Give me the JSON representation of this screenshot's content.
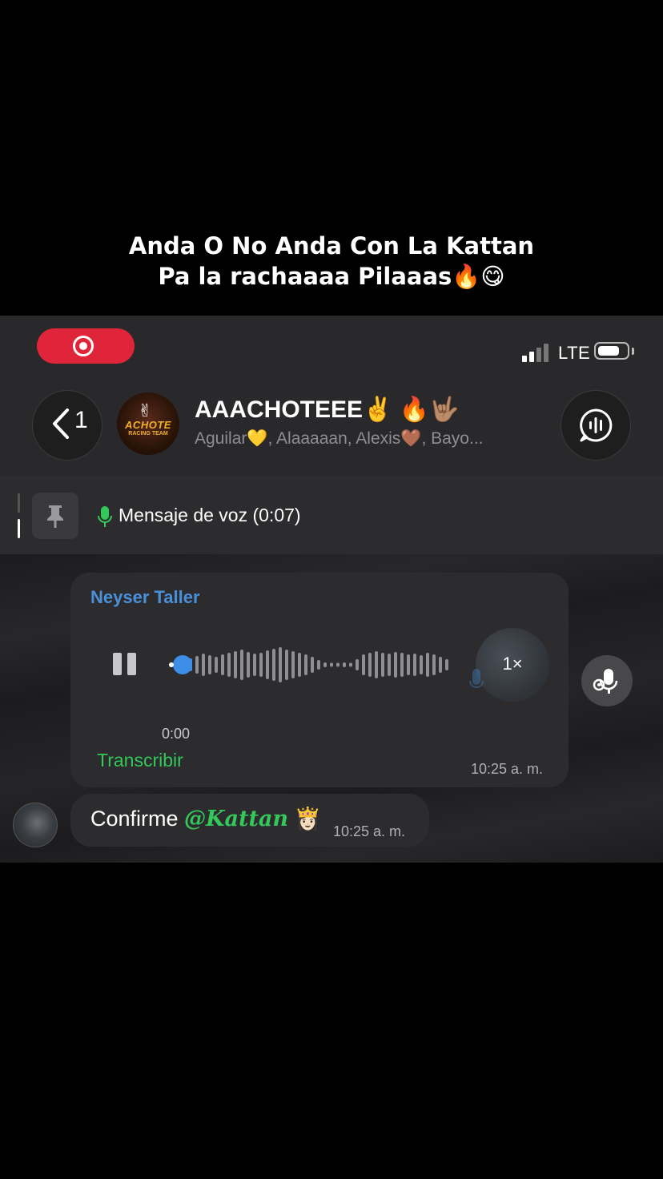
{
  "caption": {
    "line1": "Anda O No Anda Con La Kattan",
    "line2": "Pa la rachaaaa Pilaaas🔥😋"
  },
  "status_bar": {
    "network": "LTE"
  },
  "header": {
    "back_count": "1",
    "title": "AAACHOTEEE✌️ 🔥🤟🏽",
    "members": "Aguilar💛, Alaaaaan, Alexis🤎, Bayo...",
    "avatar_text": "ACHOTE",
    "avatar_subtext": "RACING TEAM"
  },
  "pinned": {
    "text": "Mensaje de voz (0:07)"
  },
  "voice_message": {
    "sender": "Neyser Taller",
    "current_time": "0:00",
    "speed": "1×",
    "transcribe_label": "Transcribir",
    "timestamp": "10:25 a. m.",
    "progress": 0
  },
  "text_message": {
    "text": "Confirme ",
    "mention": "@Kattan",
    "emoji": "👸🏻",
    "timestamp": "10:25 a. m."
  },
  "colors": {
    "record_red": "#e0253a",
    "sender_blue": "#4a90d9",
    "accent_green": "#34c759",
    "bubble_bg": "#2c2c2e"
  }
}
